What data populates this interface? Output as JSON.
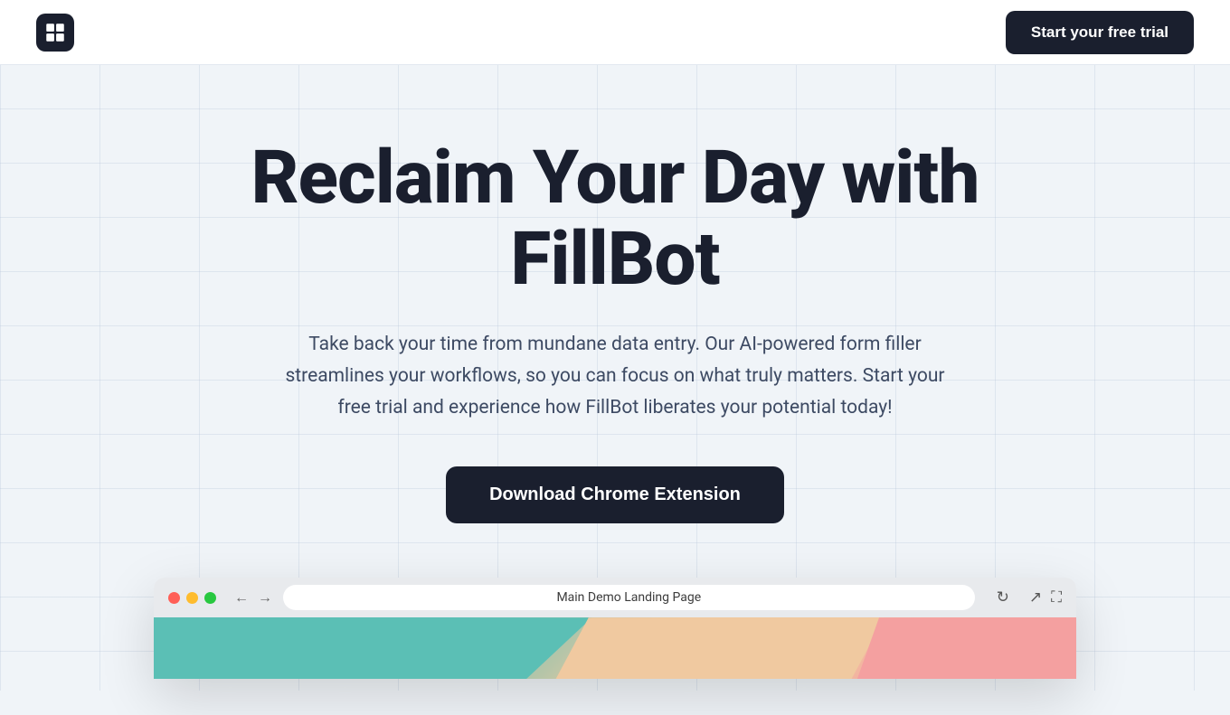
{
  "navbar": {
    "logo_alt": "FillBot logo",
    "cta_label": "Start your free trial"
  },
  "hero": {
    "title_line1": "Reclaim Your Day with",
    "title_line2": "FillBot",
    "subtitle": "Take back your time from mundane data entry. Our AI-powered form filler streamlines your workflows, so you can focus on what truly matters. Start your free trial and experience how FillBot liberates your potential today!",
    "download_label": "Download Chrome Extension"
  },
  "browser_mockup": {
    "address_text": "Main Demo Landing Page",
    "dots": [
      "red",
      "yellow",
      "green"
    ]
  },
  "colors": {
    "dark": "#1a1f2e",
    "background": "#f0f4f8",
    "text_body": "#3d4a63"
  }
}
